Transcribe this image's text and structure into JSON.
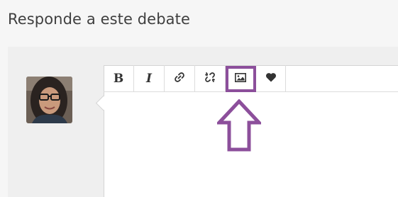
{
  "heading": "Responde a este debate",
  "toolbar": {
    "bold_label": "B",
    "italic_label": "I",
    "buttons": [
      "bold",
      "italic",
      "link",
      "unlink",
      "image",
      "heart"
    ]
  },
  "colors": {
    "highlight": "#8c4f9b",
    "toolbar_icon": "#333333",
    "panel_bg": "#efefef"
  },
  "icons": [
    "link-icon",
    "unlink-icon",
    "image-icon",
    "heart-icon",
    "up-arrow-icon"
  ]
}
